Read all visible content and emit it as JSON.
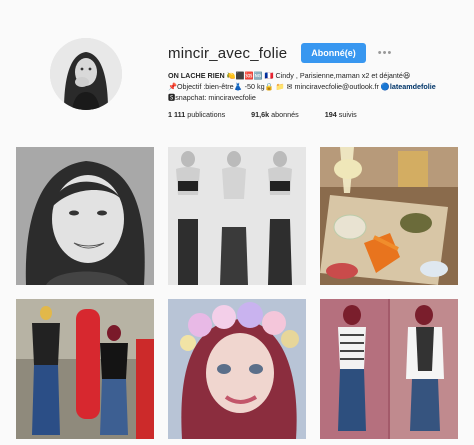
{
  "profile": {
    "username": "mincir_avec_folie",
    "follow_label": "Abonné(e)",
    "more_label": "•••",
    "bio": {
      "headline": "ON LACHE RIEN",
      "headline_rest": " 🍋⬛️🆘🆖 🇫🇷 Cindy , Parisienne,maman x2 et déjanté😆",
      "line2": "📌Objectif :bien-être👗 -50 kg🔒 📁 ✉ minciravecfolie@outlook.fr",
      "link": "🔵lateamdefolie",
      "line3": "🆂snapchat: minciravecfolie"
    },
    "stats": {
      "posts_count": "1 111",
      "posts_label": "publications",
      "followers_count": "91,6k",
      "followers_label": "abonnés",
      "following_count": "194",
      "following_label": "suivis"
    }
  },
  "posts": [
    {
      "desc": "selfie-bw"
    },
    {
      "desc": "before-after-bw"
    },
    {
      "desc": "food-platter"
    },
    {
      "desc": "before-after-color"
    },
    {
      "desc": "flower-crown-selfie"
    },
    {
      "desc": "mirror-selfies"
    }
  ]
}
